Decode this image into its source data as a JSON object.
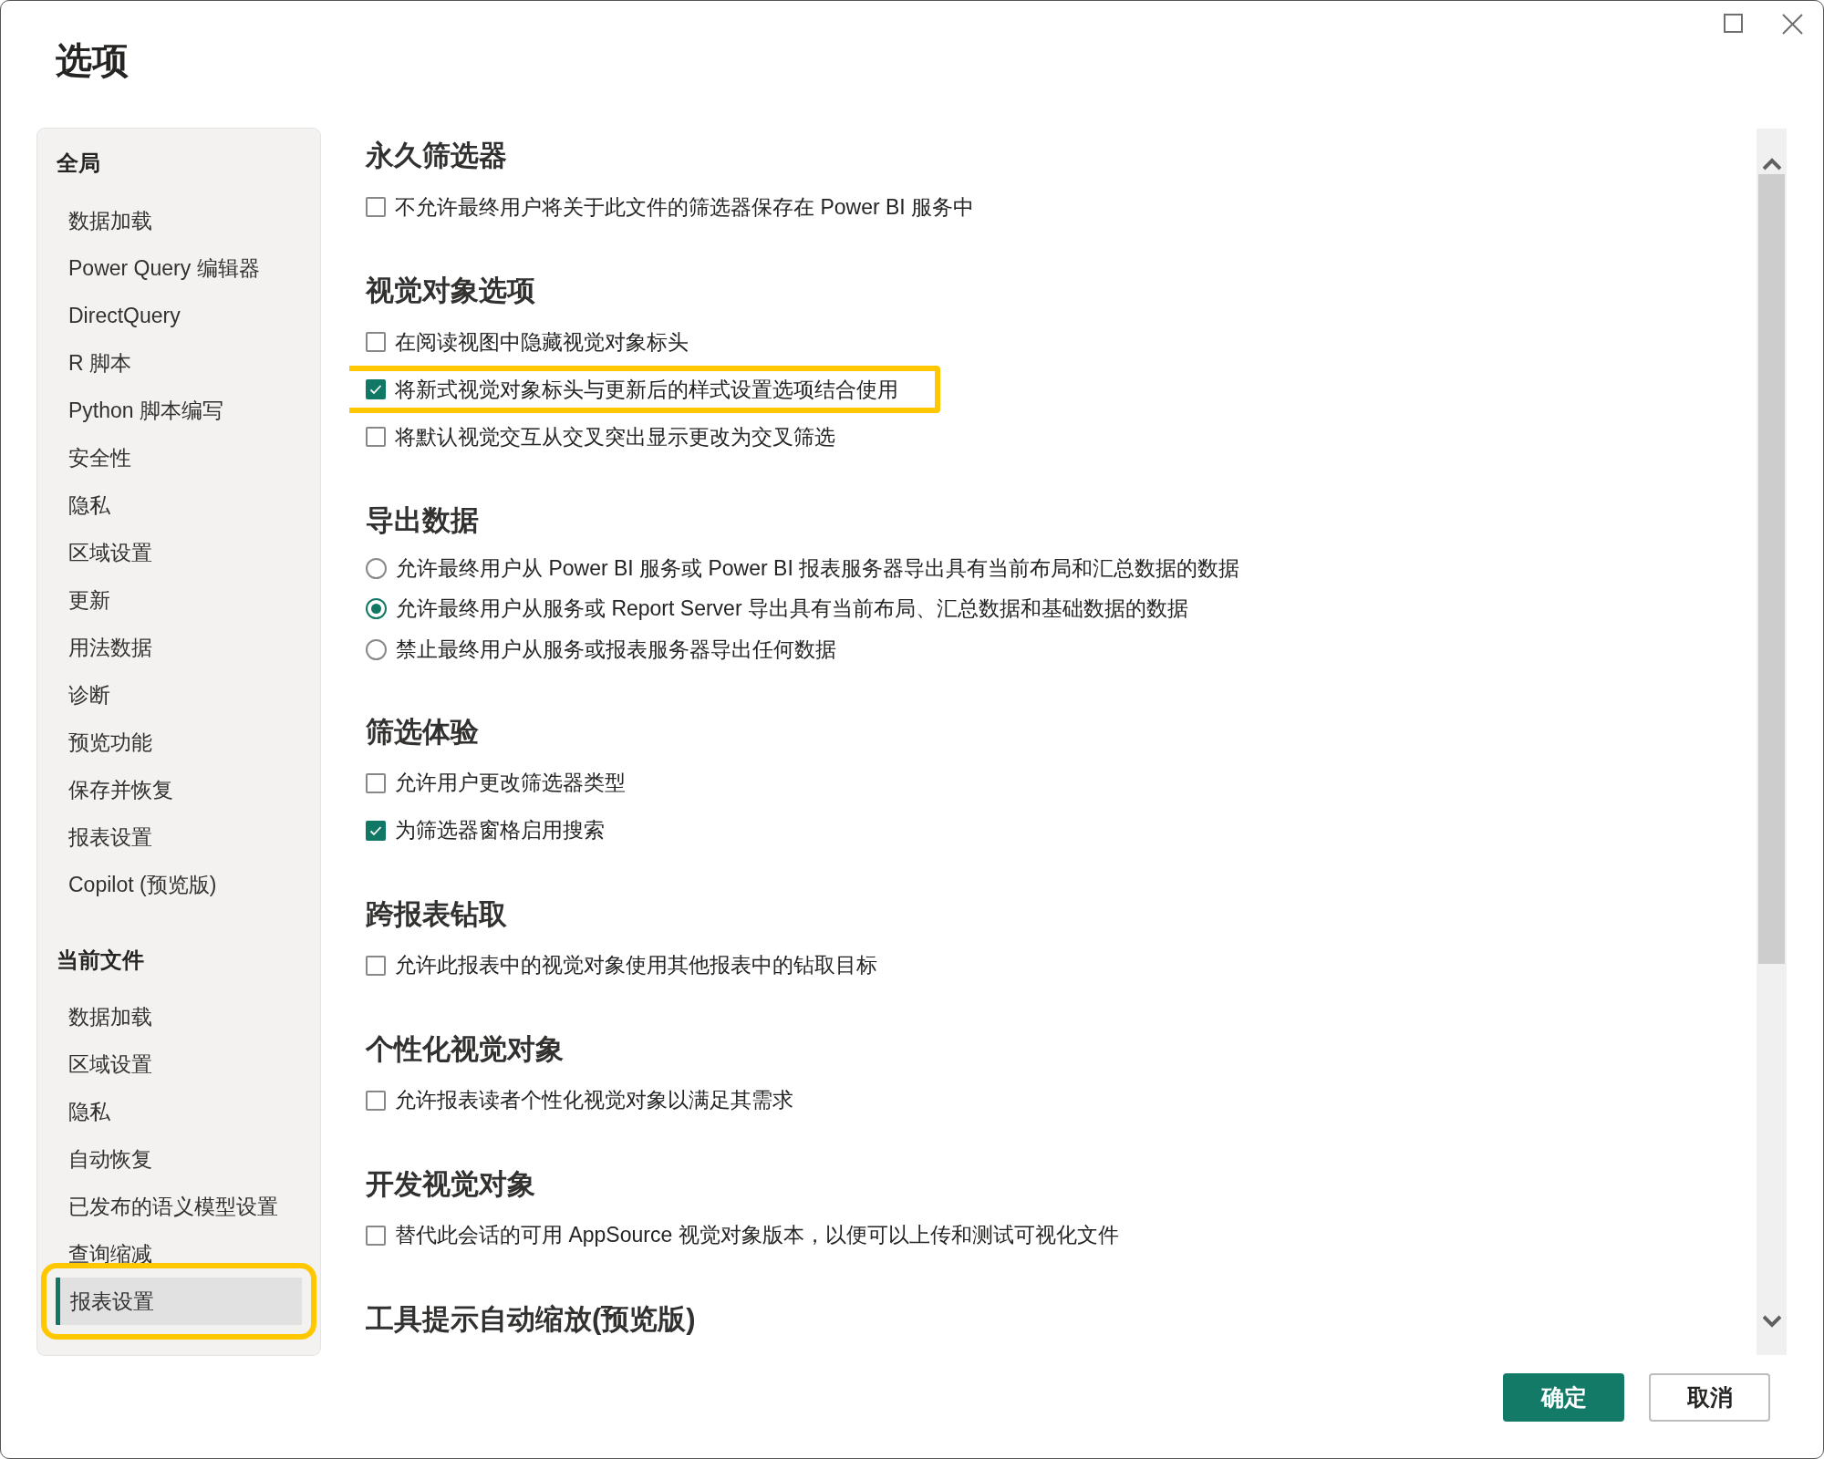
{
  "window": {
    "title": "选项"
  },
  "sidebar": {
    "groups": [
      {
        "heading": "全局",
        "items": [
          {
            "label": "数据加载",
            "selected": false,
            "highlighted": false
          },
          {
            "label": "Power Query 编辑器",
            "selected": false,
            "highlighted": false
          },
          {
            "label": "DirectQuery",
            "selected": false,
            "highlighted": false
          },
          {
            "label": "R 脚本",
            "selected": false,
            "highlighted": false
          },
          {
            "label": "Python 脚本编写",
            "selected": false,
            "highlighted": false
          },
          {
            "label": "安全性",
            "selected": false,
            "highlighted": false
          },
          {
            "label": "隐私",
            "selected": false,
            "highlighted": false
          },
          {
            "label": "区域设置",
            "selected": false,
            "highlighted": false
          },
          {
            "label": "更新",
            "selected": false,
            "highlighted": false
          },
          {
            "label": "用法数据",
            "selected": false,
            "highlighted": false
          },
          {
            "label": "诊断",
            "selected": false,
            "highlighted": false
          },
          {
            "label": "预览功能",
            "selected": false,
            "highlighted": false
          },
          {
            "label": "保存并恢复",
            "selected": false,
            "highlighted": false
          },
          {
            "label": "报表设置",
            "selected": false,
            "highlighted": false
          },
          {
            "label": "Copilot (预览版)",
            "selected": false,
            "highlighted": false
          }
        ]
      },
      {
        "heading": "当前文件",
        "items": [
          {
            "label": "数据加载",
            "selected": false,
            "highlighted": false
          },
          {
            "label": "区域设置",
            "selected": false,
            "highlighted": false
          },
          {
            "label": "隐私",
            "selected": false,
            "highlighted": false
          },
          {
            "label": "自动恢复",
            "selected": false,
            "highlighted": false
          },
          {
            "label": "已发布的语义模型设置",
            "selected": false,
            "highlighted": false
          },
          {
            "label": "查询缩减",
            "selected": false,
            "highlighted": false
          },
          {
            "label": "报表设置",
            "selected": true,
            "highlighted": true
          }
        ]
      }
    ]
  },
  "sections": [
    {
      "heading": "永久筛选器",
      "options": [
        {
          "kind": "checkbox",
          "label": "不允许最终用户将关于此文件的筛选器保存在 Power BI 服务中",
          "checked": false,
          "highlighted": false
        }
      ]
    },
    {
      "heading": "视觉对象选项",
      "options": [
        {
          "kind": "checkbox",
          "label": "在阅读视图中隐藏视觉对象标头",
          "checked": false,
          "highlighted": false
        },
        {
          "kind": "checkbox",
          "label": "将新式视觉对象标头与更新后的样式设置选项结合使用",
          "checked": true,
          "highlighted": true
        },
        {
          "kind": "checkbox",
          "label": "将默认视觉交互从交叉突出显示更改为交叉筛选",
          "checked": false,
          "highlighted": false
        }
      ]
    },
    {
      "heading": "导出数据",
      "options": [
        {
          "kind": "radio",
          "label": "允许最终用户从 Power BI 服务或 Power BI 报表服务器导出具有当前布局和汇总数据的数据",
          "checked": false,
          "highlighted": false
        },
        {
          "kind": "radio",
          "label": "允许最终用户从服务或 Report Server 导出具有当前布局、汇总数据和基础数据的数据",
          "checked": true,
          "highlighted": false
        },
        {
          "kind": "radio",
          "label": "禁止最终用户从服务或报表服务器导出任何数据",
          "checked": false,
          "highlighted": false
        }
      ]
    },
    {
      "heading": "筛选体验",
      "options": [
        {
          "kind": "checkbox",
          "label": "允许用户更改筛选器类型",
          "checked": false,
          "highlighted": false
        },
        {
          "kind": "checkbox",
          "label": "为筛选器窗格启用搜索",
          "checked": true,
          "highlighted": false
        }
      ]
    },
    {
      "heading": "跨报表钻取",
      "options": [
        {
          "kind": "checkbox",
          "label": "允许此报表中的视觉对象使用其他报表中的钻取目标",
          "checked": false,
          "highlighted": false
        }
      ]
    },
    {
      "heading": "个性化视觉对象",
      "options": [
        {
          "kind": "checkbox",
          "label": "允许报表读者个性化视觉对象以满足其需求",
          "checked": false,
          "highlighted": false
        }
      ]
    },
    {
      "heading": "开发视觉对象",
      "options": [
        {
          "kind": "checkbox",
          "label": "替代此会话的可用 AppSource 视觉对象版本，以便可以上传和测试可视化文件",
          "checked": false,
          "highlighted": false
        }
      ]
    },
    {
      "heading": "工具提示自动缩放(预览版)"
    }
  ],
  "buttons": [
    {
      "label": "确定",
      "kind": "primary"
    },
    {
      "label": "取消",
      "kind": "secondary"
    }
  ]
}
